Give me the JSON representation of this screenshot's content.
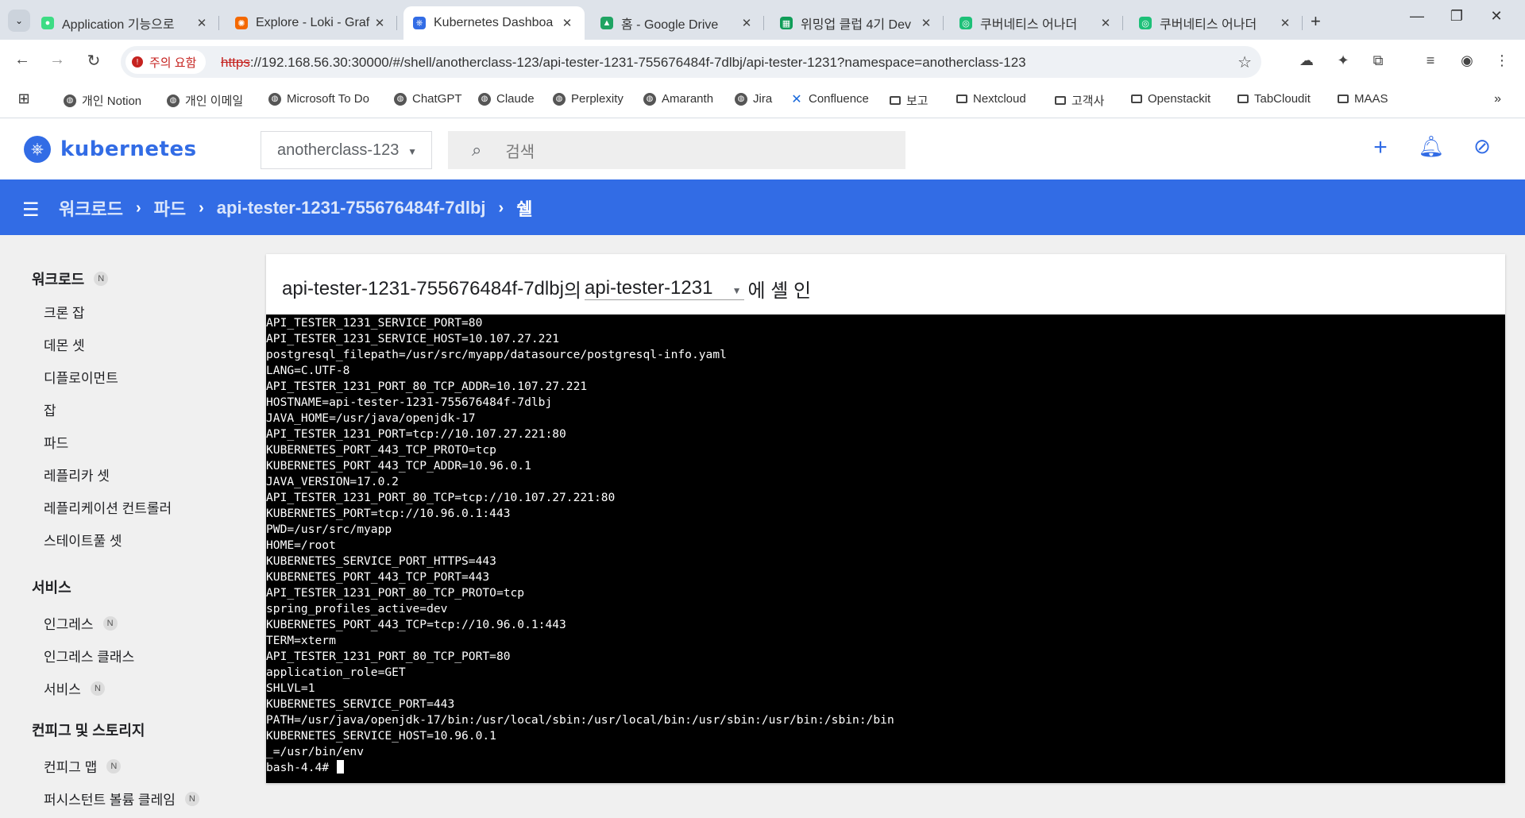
{
  "browser": {
    "tabs": [
      {
        "title": "Application 기능으로",
        "favicon": "android",
        "color": "#3ddc84"
      },
      {
        "title": "Explore - Loki - Graf",
        "favicon": "grafana",
        "color": "#f46800"
      },
      {
        "title": "Kubernetes Dashboa",
        "favicon": "kubernetes",
        "color": "#326ce5",
        "active": true
      },
      {
        "title": "홈 - Google Drive",
        "favicon": "google-drive",
        "color": "#1fa463"
      },
      {
        "title": "위밍업 클럽 4기 Dev",
        "favicon": "google-sheets",
        "color": "#0f9d58"
      },
      {
        "title": "쿠버네티스 어나더",
        "favicon": "inflearn",
        "color": "#1dc078"
      },
      {
        "title": "쿠버네티스 어나더",
        "favicon": "inflearn",
        "color": "#1dc078"
      }
    ],
    "security_warning": "주의 요함",
    "url_protocol": "https",
    "url_rest": "://192.168.56.30:30000/#/shell/anotherclass-123/api-tester-1231-755676484f-7dlbj/api-tester-1231?namespace=anotherclass-123",
    "bookmarks": [
      {
        "label": "개인 Notion",
        "icon": "globe"
      },
      {
        "label": "개인 이메일",
        "icon": "globe"
      },
      {
        "label": "Microsoft To Do",
        "icon": "globe"
      },
      {
        "label": "ChatGPT",
        "icon": "globe"
      },
      {
        "label": "Claude",
        "icon": "globe"
      },
      {
        "label": "Perplexity",
        "icon": "globe"
      },
      {
        "label": "Amaranth",
        "icon": "globe"
      },
      {
        "label": "Jira",
        "icon": "globe"
      },
      {
        "label": "Confluence",
        "icon": "confluence"
      },
      {
        "label": "보고",
        "icon": "folder"
      },
      {
        "label": "Nextcloud",
        "icon": "folder"
      },
      {
        "label": "고객사",
        "icon": "folder"
      },
      {
        "label": "Openstackit",
        "icon": "folder"
      },
      {
        "label": "TabCloudit",
        "icon": "folder"
      },
      {
        "label": "MAAS",
        "icon": "folder"
      }
    ]
  },
  "header": {
    "brand": "kubernetes",
    "namespace": "anotherclass-123",
    "search_placeholder": "검색"
  },
  "breadcrumb": {
    "items": [
      "워크로드",
      "파드",
      "api-tester-1231-755676484f-7dlbj"
    ],
    "current": "쉘"
  },
  "sidebar": {
    "sections": [
      {
        "title": "워크로드",
        "badge": "N",
        "items": [
          {
            "label": "크론 잡"
          },
          {
            "label": "데몬 셋"
          },
          {
            "label": "디플로이먼트"
          },
          {
            "label": "잡"
          },
          {
            "label": "파드"
          },
          {
            "label": "레플리카 셋"
          },
          {
            "label": "레플리케이션 컨트롤러"
          },
          {
            "label": "스테이트풀 셋"
          }
        ]
      },
      {
        "title": "서비스",
        "items": [
          {
            "label": "인그레스",
            "badge": "N"
          },
          {
            "label": "인그레스 클래스"
          },
          {
            "label": "서비스",
            "badge": "N"
          }
        ]
      },
      {
        "title": "컨피그 및 스토리지",
        "items": [
          {
            "label": "컨피그 맵",
            "badge": "N"
          },
          {
            "label": "퍼시스턴트 볼륨 클레임",
            "badge": "N"
          }
        ]
      }
    ]
  },
  "shell": {
    "pod": "api-tester-1231-755676484f-7dlbj",
    "of": "의",
    "container": "api-tester-1231",
    "suffix": "에 셸 인",
    "output": [
      "API_TESTER_1231_SERVICE_PORT=80",
      "API_TESTER_1231_SERVICE_HOST=10.107.27.221",
      "postgresql_filepath=/usr/src/myapp/datasource/postgresql-info.yaml",
      "LANG=C.UTF-8",
      "API_TESTER_1231_PORT_80_TCP_ADDR=10.107.27.221",
      "HOSTNAME=api-tester-1231-755676484f-7dlbj",
      "JAVA_HOME=/usr/java/openjdk-17",
      "API_TESTER_1231_PORT=tcp://10.107.27.221:80",
      "KUBERNETES_PORT_443_TCP_PROTO=tcp",
      "KUBERNETES_PORT_443_TCP_ADDR=10.96.0.1",
      "JAVA_VERSION=17.0.2",
      "API_TESTER_1231_PORT_80_TCP=tcp://10.107.27.221:80",
      "KUBERNETES_PORT=tcp://10.96.0.1:443",
      "PWD=/usr/src/myapp",
      "HOME=/root",
      "KUBERNETES_SERVICE_PORT_HTTPS=443",
      "KUBERNETES_PORT_443_TCP_PORT=443",
      "API_TESTER_1231_PORT_80_TCP_PROTO=tcp",
      "spring_profiles_active=dev",
      "KUBERNETES_PORT_443_TCP=tcp://10.96.0.1:443",
      "TERM=xterm",
      "API_TESTER_1231_PORT_80_TCP_PORT=80",
      "application_role=GET",
      "SHLVL=1",
      "KUBERNETES_SERVICE_PORT=443",
      "PATH=/usr/java/openjdk-17/bin:/usr/local/sbin:/usr/local/bin:/usr/sbin:/usr/bin:/sbin:/bin",
      "KUBERNETES_SERVICE_HOST=10.96.0.1",
      "_=/usr/bin/env"
    ],
    "prompt": "bash-4.4# "
  }
}
